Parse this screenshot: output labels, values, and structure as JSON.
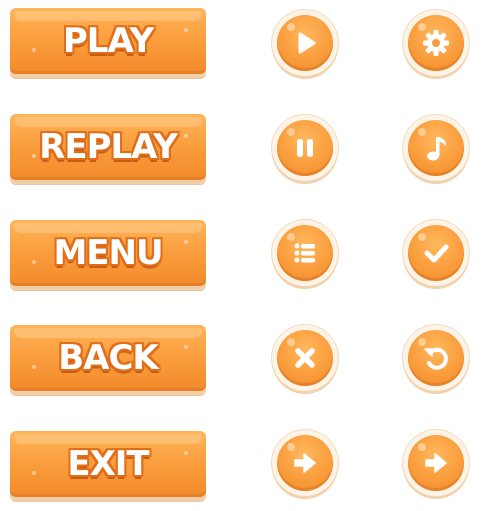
{
  "buttons": {
    "play": "PLAY",
    "replay": "REPLAY",
    "menu": "MENU",
    "back": "BACK",
    "exit": "EXIT"
  },
  "icons": {
    "row1": [
      "play-icon",
      "gear-icon"
    ],
    "row2": [
      "pause-icon",
      "music-note-icon"
    ],
    "row3": [
      "list-icon",
      "checkmark-icon"
    ],
    "row4": [
      "close-icon",
      "undo-icon"
    ],
    "row5": [
      "arrow-right-icon",
      "arrow-right-icon"
    ]
  },
  "colors": {
    "button_orange": "#f99b3a",
    "button_light": "#ffb45a",
    "outline_orange": "#e06e1a",
    "rim_cream": "#fdf3e6",
    "glyph_white": "#ffffff"
  }
}
